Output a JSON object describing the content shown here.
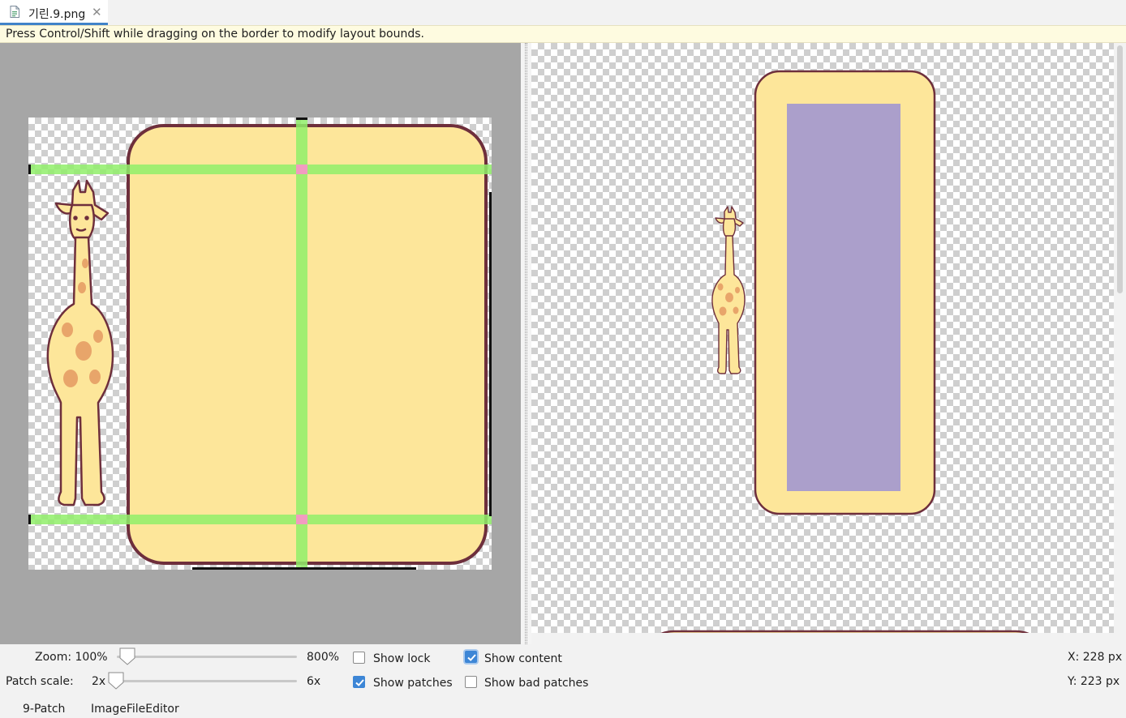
{
  "tab": {
    "filename": "기린.9.png",
    "close_glyph": "✕",
    "icon": "image-file-icon"
  },
  "hint": "Press Control/Shift while dragging on the border to modify layout bounds.",
  "controls": {
    "zoom": {
      "label": "Zoom: 100%",
      "max_label": "800%",
      "value_fraction": 0.0
    },
    "patch_scale": {
      "label": "Patch scale:",
      "min_label": "2x",
      "max_label": "6x",
      "value_fraction": 0.0
    },
    "checkboxes": {
      "show_lock": {
        "label": "Show lock",
        "checked": false
      },
      "show_patches": {
        "label": "Show patches",
        "checked": true
      },
      "show_content": {
        "label": "Show content",
        "checked": true
      },
      "show_bad_patches": {
        "label": "Show bad patches",
        "checked": false
      }
    },
    "coords": {
      "x": "X: 228 px",
      "y": "Y: 223 px"
    }
  },
  "bottom_tabs": [
    "9-Patch",
    "ImageFileEditor"
  ],
  "colors": {
    "accent": "#4083c9",
    "patch_green": "#90ee6a",
    "patch_overlap": "#f29bc0",
    "frame_fill": "#fde69a",
    "frame_border": "#6e2f3c",
    "content_area": "#ab9fcb",
    "editor_bg": "#a6a6a6"
  }
}
